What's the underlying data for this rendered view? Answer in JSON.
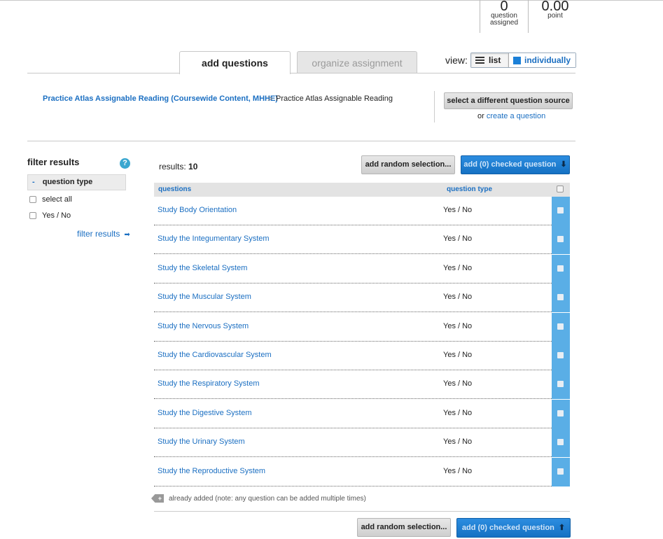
{
  "stats": {
    "questions_count": "0",
    "questions_label_1": "question",
    "questions_label_2": "assigned",
    "points_count": "0.00",
    "points_label": "point"
  },
  "tabs": [
    {
      "label": "add questions",
      "active": true
    },
    {
      "label": "organize assignment",
      "active": false
    }
  ],
  "view": {
    "label": "view:",
    "options": [
      "list",
      "individually"
    ],
    "selected": "list"
  },
  "source": {
    "link": "Practice Atlas Assignable Reading (Coursewide Content, MHHE)",
    "separator": ">",
    "current": "Practice Atlas Assignable Reading",
    "change_button": "select a different question source",
    "or_text": "or",
    "create_link": "create a question"
  },
  "filter": {
    "title": "filter results",
    "help": "?",
    "group_toggle": "-",
    "group_label": "question type",
    "options": [
      "select all",
      "Yes / No"
    ],
    "apply_link": "filter results"
  },
  "results": {
    "label": "results:",
    "count": "10",
    "random_button": "add random selection...",
    "add_button": "add (0) checked question",
    "headers": {
      "question": "questions",
      "type": "question type"
    },
    "rows": [
      {
        "title": "Study Body Orientation",
        "type": "Yes / No"
      },
      {
        "title": "Study the Integumentary System",
        "type": "Yes / No"
      },
      {
        "title": "Study the Skeletal System",
        "type": "Yes / No"
      },
      {
        "title": "Study the Muscular System",
        "type": "Yes / No"
      },
      {
        "title": "Study the Nervous System",
        "type": "Yes / No"
      },
      {
        "title": "Study the Cardiovascular System",
        "type": "Yes / No"
      },
      {
        "title": "Study the Respiratory System",
        "type": "Yes / No"
      },
      {
        "title": "Study the Digestive System",
        "type": "Yes / No"
      },
      {
        "title": "Study the Urinary System",
        "type": "Yes / No"
      },
      {
        "title": "Study the Reproductive System",
        "type": "Yes / No"
      }
    ],
    "legend": "already added (note: any question can be added multiple times)"
  },
  "colors": {
    "link": "#1b6fc2",
    "primary_button": "#1b80d8",
    "selection_column": "#5aaee6"
  }
}
